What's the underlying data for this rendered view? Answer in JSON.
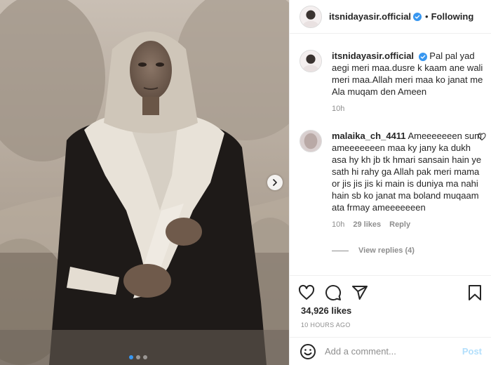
{
  "header": {
    "username": "itsnidayasir.official",
    "separator": "•",
    "follow_label": "Following"
  },
  "comments": [
    {
      "username": "itsnidayasir.official",
      "text": "Pal pal yad aegi meri maa.dusre k kaam ane wali meri maa.Allah meri maa ko janat me Ala muqam den Ameen",
      "time": "10h"
    },
    {
      "username": "malaika_ch_4411",
      "text": "Ameeeeeeen sum ameeeeeeen maa ky jany ka dukh asa hy kh jb tk hmari sansain hain ye sath hi rahy ga Allah pak meri mama or jis jis jis ki main is duniya ma nahi hain sb ko janat ma boland muqaam ata frmay ameeeeeeen",
      "time": "10h",
      "likes": "29 likes",
      "reply_label": "Reply",
      "view_replies": "View replies (4)"
    }
  ],
  "post": {
    "likes": "34,926 likes",
    "time_ago": "10 HOURS AGO"
  },
  "add_comment": {
    "placeholder": "Add a comment...",
    "post_label": "Post"
  },
  "carousel": {
    "current": 1,
    "total": 3
  },
  "colors": {
    "verified": "#3897f0",
    "post_disabled": "#b2dffc",
    "muted": "#8e8e8e"
  },
  "icons": {
    "like": "heart-icon",
    "comment": "comment-icon",
    "share": "share-icon",
    "save": "bookmark-icon",
    "emoji": "emoji-icon",
    "next": "chevron-right-icon"
  }
}
